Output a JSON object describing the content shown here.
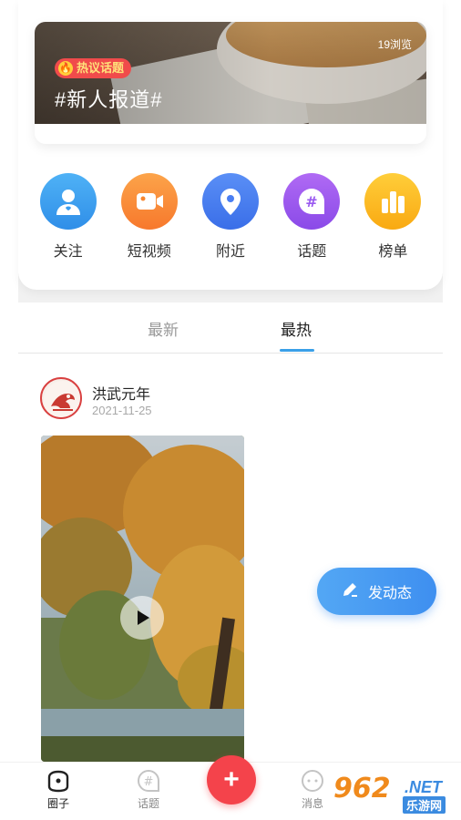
{
  "banner": {
    "views": "19浏览",
    "badge": "热议话题",
    "title": "#新人报道#"
  },
  "shortcuts": [
    {
      "label": "关注",
      "icon": "follow-user-icon",
      "color": "#3a9df0"
    },
    {
      "label": "短视频",
      "icon": "video-camera-icon",
      "color": "#fa8a3a"
    },
    {
      "label": "附近",
      "icon": "location-pin-icon",
      "color": "#4a7ef2"
    },
    {
      "label": "话题",
      "icon": "hashtag-chat-icon",
      "color": "#9a5af0"
    },
    {
      "label": "榜单",
      "icon": "ranking-bars-icon",
      "color": "#fcb81c"
    }
  ],
  "tabs": {
    "latest": "最新",
    "hot": "最热",
    "active": "hot"
  },
  "post": {
    "user_name": "洪武元年",
    "date": "2021-11-25"
  },
  "fab": {
    "label": "发动态"
  },
  "bottom_nav": {
    "circle": "圈子",
    "topic": "话题",
    "message": "消息",
    "active": "circle"
  },
  "watermark": {
    "brand": "962",
    "net": ".NET",
    "site": "乐游网"
  }
}
